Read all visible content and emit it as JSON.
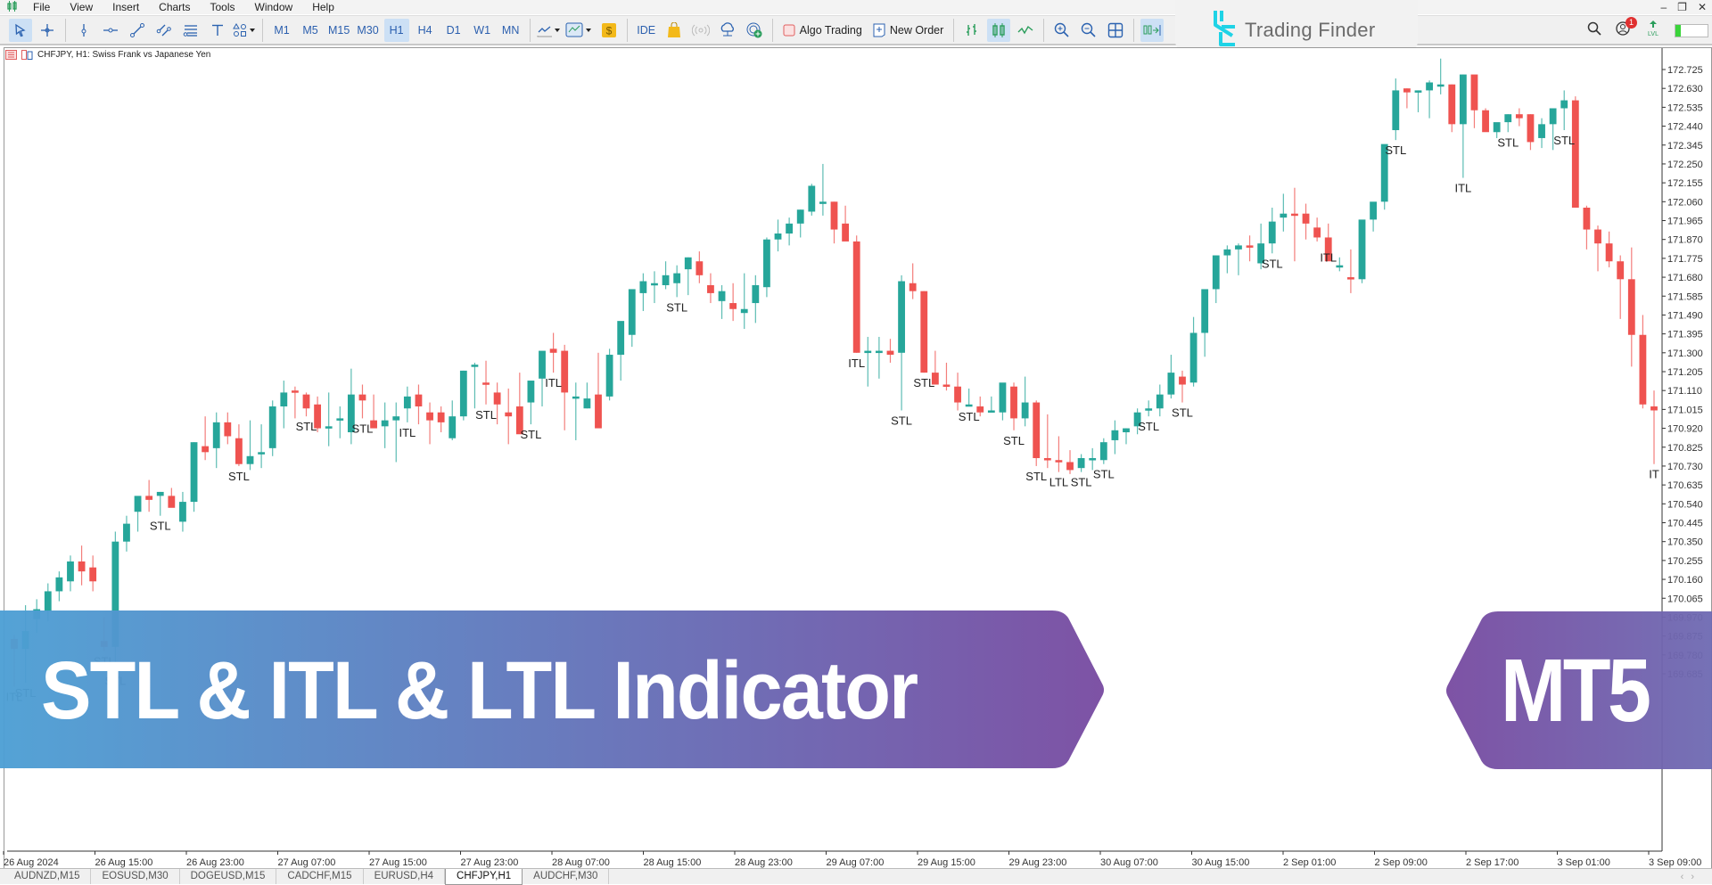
{
  "menu": {
    "items": [
      "File",
      "View",
      "Insert",
      "Charts",
      "Tools",
      "Window",
      "Help"
    ]
  },
  "window_controls": [
    "minimize",
    "restore",
    "close"
  ],
  "toolbar": {
    "tools": [
      {
        "name": "cursor-icon",
        "active": true
      },
      {
        "name": "crosshair-icon",
        "active": false
      },
      {
        "name": "vertical-line-icon",
        "active": false
      },
      {
        "name": "horizontal-line-icon",
        "active": false
      },
      {
        "name": "trendline-icon",
        "active": false
      },
      {
        "name": "channel-icon",
        "active": false
      },
      {
        "name": "fibonacci-icon",
        "active": false
      },
      {
        "name": "text-icon",
        "active": false
      },
      {
        "name": "shapes-icon",
        "active": false
      }
    ],
    "timeframes": [
      "M1",
      "M5",
      "M15",
      "M30",
      "H1",
      "H4",
      "D1",
      "W1",
      "MN"
    ],
    "active_timeframe": "H1",
    "ide_label": "IDE",
    "algo_trading_label": "Algo Trading",
    "new_order_label": "New Order"
  },
  "brand": {
    "name": "Trading Finder"
  },
  "notifications_count": "1",
  "chart": {
    "title": "CHFJPY, H1:  Swiss Frank vs Japanese Yen"
  },
  "tabs": [
    {
      "label": "AUDNZD,M15",
      "active": false
    },
    {
      "label": "EOSUSD,M30",
      "active": false
    },
    {
      "label": "DOGEUSD,M15",
      "active": false
    },
    {
      "label": "CADCHF,M15",
      "active": false
    },
    {
      "label": "EURUSD,H4",
      "active": false
    },
    {
      "label": "CHFJPY,H1",
      "active": true
    },
    {
      "label": "AUDCHF,M30",
      "active": false
    }
  ],
  "banner": {
    "title": "STL & ITL & LTL Indicator",
    "platform": "MT5",
    "gradient_start": "#4d9fd4",
    "gradient_end": "#7b4fa3"
  },
  "chart_data": {
    "type": "candlestick",
    "title": "CHFJPY, H1:  Swiss Frank vs Japanese Yen",
    "symbol": "CHFJPY",
    "timeframe": "H1",
    "bull_color": "#26a69a",
    "bear_color": "#ef5350",
    "ylim": [
      169.62,
      172.82
    ],
    "y_ticks": [
      "172.725",
      "172.630",
      "172.535",
      "172.440",
      "172.345",
      "172.250",
      "172.155",
      "172.060",
      "171.965",
      "171.870",
      "171.775",
      "171.680",
      "171.585",
      "171.490",
      "171.395",
      "171.300",
      "171.205",
      "171.110",
      "171.015",
      "170.920",
      "170.825",
      "170.730",
      "170.635",
      "170.540",
      "170.445",
      "170.350",
      "170.255",
      "170.160",
      "170.065",
      "169.970",
      "169.875",
      "169.780",
      "169.685"
    ],
    "x_ticks": [
      "26 Aug 2024",
      "26 Aug 15:00",
      "26 Aug 23:00",
      "27 Aug 07:00",
      "27 Aug 15:00",
      "27 Aug 23:00",
      "28 Aug 07:00",
      "28 Aug 15:00",
      "28 Aug 23:00",
      "29 Aug 07:00",
      "29 Aug 15:00",
      "29 Aug 23:00",
      "30 Aug 07:00",
      "30 Aug 15:00",
      "2 Sep 01:00",
      "2 Sep 09:00",
      "2 Sep 17:00",
      "3 Sep 01:00",
      "3 Sep 09:00"
    ],
    "candles": [
      [
        169.86,
        169.88,
        169.62,
        169.81
      ],
      [
        169.81,
        170.03,
        169.64,
        169.9
      ],
      [
        169.96,
        170.06,
        169.89,
        170.01
      ],
      [
        170.0,
        170.14,
        169.95,
        170.1
      ],
      [
        170.1,
        170.2,
        170.05,
        170.17
      ],
      [
        170.15,
        170.28,
        170.1,
        170.25
      ],
      [
        170.25,
        170.33,
        170.13,
        170.2
      ],
      [
        170.22,
        170.28,
        170.1,
        170.15
      ],
      [
        169.85,
        169.97,
        169.8,
        169.82
      ],
      [
        169.82,
        170.4,
        169.7,
        170.35
      ],
      [
        170.35,
        170.48,
        170.3,
        170.44
      ],
      [
        170.5,
        170.56,
        170.4,
        170.58
      ],
      [
        170.58,
        170.66,
        170.5,
        170.56
      ],
      [
        170.58,
        170.6,
        170.48,
        170.6
      ],
      [
        170.58,
        170.62,
        170.53,
        170.52
      ],
      [
        170.45,
        170.6,
        170.4,
        170.55
      ],
      [
        170.55,
        170.85,
        170.5,
        170.85
      ],
      [
        170.83,
        170.98,
        170.76,
        170.8
      ],
      [
        170.82,
        171.0,
        170.72,
        170.95
      ],
      [
        170.95,
        171.0,
        170.84,
        170.88
      ],
      [
        170.87,
        170.94,
        170.73,
        170.74
      ],
      [
        170.74,
        170.96,
        170.71,
        170.78
      ],
      [
        170.8,
        170.94,
        170.72,
        170.8
      ],
      [
        170.82,
        171.06,
        170.78,
        171.03
      ],
      [
        171.03,
        171.16,
        170.92,
        171.1
      ],
      [
        171.11,
        171.13,
        170.97,
        171.1
      ],
      [
        171.09,
        171.1,
        170.98,
        171.02
      ],
      [
        171.04,
        171.08,
        170.9,
        170.92
      ],
      [
        170.93,
        171.1,
        170.83,
        170.93
      ],
      [
        170.97,
        171.03,
        170.87,
        170.97
      ],
      [
        170.9,
        171.22,
        170.84,
        171.09
      ],
      [
        171.09,
        171.14,
        170.97,
        171.06
      ],
      [
        170.96,
        171.09,
        170.93,
        170.92
      ],
      [
        170.93,
        171.05,
        170.82,
        170.96
      ],
      [
        170.96,
        171.05,
        170.75,
        170.98
      ],
      [
        171.02,
        171.13,
        170.95,
        171.08
      ],
      [
        171.09,
        171.14,
        170.94,
        171.03
      ],
      [
        171.0,
        171.05,
        170.84,
        170.96
      ],
      [
        171.0,
        171.03,
        170.9,
        170.95
      ],
      [
        170.87,
        171.06,
        170.86,
        170.98
      ],
      [
        170.98,
        171.21,
        170.96,
        171.21
      ],
      [
        171.23,
        171.25,
        171.02,
        171.24
      ],
      [
        171.15,
        171.26,
        171.04,
        171.14
      ],
      [
        171.1,
        171.15,
        170.94,
        171.04
      ],
      [
        171.0,
        171.12,
        170.84,
        170.98
      ],
      [
        171.03,
        171.2,
        170.95,
        170.89
      ],
      [
        171.05,
        171.13,
        170.94,
        171.16
      ],
      [
        171.17,
        171.26,
        171.03,
        171.31
      ],
      [
        171.32,
        171.4,
        171.2,
        171.3
      ],
      [
        171.31,
        171.34,
        170.91,
        171.1
      ],
      [
        171.07,
        171.15,
        170.86,
        171.08
      ],
      [
        171.02,
        171.15,
        171.02,
        171.07
      ],
      [
        171.09,
        171.3,
        171.06,
        170.92
      ],
      [
        171.08,
        171.32,
        171.06,
        171.29
      ],
      [
        171.29,
        171.43,
        171.16,
        171.46
      ],
      [
        171.39,
        171.56,
        171.33,
        171.62
      ],
      [
        171.6,
        171.7,
        171.51,
        171.66
      ],
      [
        171.65,
        171.71,
        171.55,
        171.65
      ],
      [
        171.64,
        171.76,
        171.62,
        171.69
      ],
      [
        171.65,
        171.74,
        171.58,
        171.7
      ],
      [
        171.72,
        171.78,
        171.59,
        171.78
      ],
      [
        171.76,
        171.81,
        171.65,
        171.69
      ],
      [
        171.64,
        171.7,
        171.55,
        171.6
      ],
      [
        171.56,
        171.64,
        171.47,
        171.61
      ],
      [
        171.55,
        171.65,
        171.46,
        171.52
      ],
      [
        171.5,
        171.7,
        171.42,
        171.52
      ],
      [
        171.55,
        171.69,
        171.45,
        171.64
      ],
      [
        171.63,
        171.88,
        171.58,
        171.87
      ],
      [
        171.87,
        171.97,
        171.81,
        171.9
      ],
      [
        171.9,
        171.98,
        171.84,
        171.95
      ],
      [
        171.95,
        172.02,
        171.88,
        172.02
      ],
      [
        172.01,
        172.15,
        171.99,
        172.14
      ],
      [
        172.06,
        172.25,
        171.99,
        172.06
      ],
      [
        172.06,
        172.06,
        171.85,
        171.92
      ],
      [
        171.95,
        172.04,
        171.87,
        171.86
      ],
      [
        171.86,
        171.89,
        171.3,
        171.3
      ],
      [
        171.31,
        171.38,
        171.13,
        171.31
      ],
      [
        171.31,
        171.38,
        171.17,
        171.31
      ],
      [
        171.31,
        171.37,
        171.25,
        171.29
      ],
      [
        171.3,
        171.69,
        171.01,
        171.66
      ],
      [
        171.65,
        171.75,
        171.57,
        171.61
      ],
      [
        171.61,
        171.61,
        171.2,
        171.2
      ],
      [
        171.2,
        171.31,
        171.15,
        171.14
      ],
      [
        171.14,
        171.25,
        171.11,
        171.13
      ],
      [
        171.13,
        171.2,
        171.01,
        171.05
      ],
      [
        171.04,
        171.12,
        171.03,
        171.04
      ],
      [
        171.03,
        171.08,
        170.98,
        171.0
      ],
      [
        171.01,
        171.08,
        171.0,
        171.01
      ],
      [
        171.0,
        171.13,
        170.96,
        171.15
      ],
      [
        171.13,
        171.15,
        170.91,
        170.97
      ],
      [
        170.97,
        171.18,
        170.93,
        171.05
      ],
      [
        171.05,
        171.06,
        170.73,
        170.77
      ],
      [
        170.77,
        170.99,
        170.72,
        170.76
      ],
      [
        170.76,
        170.88,
        170.7,
        170.75
      ],
      [
        170.75,
        170.81,
        170.69,
        170.71
      ],
      [
        170.72,
        170.79,
        170.7,
        170.77
      ],
      [
        170.77,
        170.82,
        170.71,
        170.77
      ],
      [
        170.76,
        170.87,
        170.74,
        170.85
      ],
      [
        170.86,
        170.96,
        170.79,
        170.91
      ],
      [
        170.9,
        170.92,
        170.84,
        170.92
      ],
      [
        170.93,
        171.02,
        170.89,
        171.0
      ],
      [
        171.02,
        171.06,
        170.98,
        171.02
      ],
      [
        171.02,
        171.14,
        170.98,
        171.09
      ],
      [
        171.09,
        171.29,
        171.07,
        171.2
      ],
      [
        171.18,
        171.21,
        171.05,
        171.14
      ],
      [
        171.15,
        171.48,
        171.13,
        171.4
      ],
      [
        171.4,
        171.61,
        171.28,
        171.62
      ],
      [
        171.62,
        171.72,
        171.55,
        171.79
      ],
      [
        171.79,
        171.84,
        171.7,
        171.82
      ],
      [
        171.82,
        171.85,
        171.69,
        171.84
      ],
      [
        171.84,
        171.89,
        171.76,
        171.83
      ],
      [
        171.75,
        171.95,
        171.72,
        171.85
      ],
      [
        171.85,
        172.03,
        171.8,
        171.96
      ],
      [
        171.98,
        172.1,
        171.91,
        172.0
      ],
      [
        172.0,
        172.13,
        171.76,
        171.99
      ],
      [
        172.0,
        172.05,
        171.87,
        171.95
      ],
      [
        171.93,
        171.98,
        171.86,
        171.88
      ],
      [
        171.88,
        171.95,
        171.83,
        171.76
      ],
      [
        171.74,
        171.78,
        171.71,
        171.74
      ],
      [
        171.68,
        171.82,
        171.6,
        171.67
      ],
      [
        171.67,
        171.92,
        171.65,
        171.97
      ],
      [
        171.97,
        172.05,
        171.91,
        172.06
      ],
      [
        172.06,
        172.34,
        172.02,
        172.35
      ],
      [
        172.42,
        172.68,
        172.37,
        172.62
      ],
      [
        172.63,
        172.63,
        172.53,
        172.61
      ],
      [
        172.61,
        172.62,
        172.51,
        172.62
      ],
      [
        172.62,
        172.67,
        172.48,
        172.66
      ],
      [
        172.64,
        172.78,
        172.6,
        172.65
      ],
      [
        172.65,
        172.65,
        172.41,
        172.45
      ],
      [
        172.45,
        172.7,
        172.18,
        172.7
      ],
      [
        172.7,
        172.69,
        172.43,
        172.52
      ],
      [
        172.52,
        172.53,
        172.48,
        172.41
      ],
      [
        172.41,
        172.44,
        172.38,
        172.46
      ],
      [
        172.46,
        172.5,
        172.41,
        172.5
      ],
      [
        172.5,
        172.53,
        172.44,
        172.48
      ],
      [
        172.5,
        172.5,
        172.32,
        172.36
      ],
      [
        172.38,
        172.48,
        172.33,
        172.45
      ],
      [
        172.45,
        172.49,
        172.32,
        172.53
      ],
      [
        172.53,
        172.62,
        172.42,
        172.57
      ],
      [
        172.57,
        172.59,
        172.04,
        172.03
      ],
      [
        172.03,
        172.04,
        171.82,
        171.92
      ],
      [
        171.92,
        171.94,
        171.71,
        171.85
      ],
      [
        171.85,
        171.91,
        171.73,
        171.76
      ],
      [
        171.76,
        171.79,
        171.47,
        171.67
      ],
      [
        171.67,
        171.83,
        171.23,
        171.39
      ],
      [
        171.39,
        171.49,
        171.02,
        171.04
      ],
      [
        171.03,
        171.11,
        170.74,
        171.01
      ]
    ],
    "labels": [
      {
        "text": "ITL",
        "candle": 0,
        "type": "ITL"
      },
      {
        "text": "STL",
        "candle": 1,
        "type": "STL"
      },
      {
        "text": "STL",
        "candle": 8,
        "type": "STL"
      },
      {
        "text": "STL",
        "candle": 9,
        "type": "STL"
      },
      {
        "text": "STL",
        "candle": 13,
        "type": "STL"
      },
      {
        "text": "STL",
        "candle": 20,
        "type": "STL"
      },
      {
        "text": "STL",
        "candle": 26,
        "type": "STL"
      },
      {
        "text": "STL",
        "candle": 31,
        "type": "STL"
      },
      {
        "text": "ITL",
        "candle": 35,
        "type": "ITL"
      },
      {
        "text": "STL",
        "candle": 42,
        "type": "STL"
      },
      {
        "text": "STL",
        "candle": 46,
        "type": "STL"
      },
      {
        "text": "ITL",
        "candle": 48,
        "type": "ITL"
      },
      {
        "text": "STL",
        "candle": 59,
        "type": "STL"
      },
      {
        "text": "ITL",
        "candle": 75,
        "type": "ITL"
      },
      {
        "text": "STL",
        "candle": 79,
        "type": "STL"
      },
      {
        "text": "STL",
        "candle": 81,
        "type": "STL"
      },
      {
        "text": "STL",
        "candle": 85,
        "type": "STL"
      },
      {
        "text": "STL",
        "candle": 89,
        "type": "STL"
      },
      {
        "text": "STL",
        "candle": 91,
        "type": "STL"
      },
      {
        "text": "LTL",
        "candle": 93,
        "type": "LTL"
      },
      {
        "text": "STL",
        "candle": 95,
        "type": "STL"
      },
      {
        "text": "STL",
        "candle": 97,
        "type": "STL"
      },
      {
        "text": "STL",
        "candle": 101,
        "type": "STL"
      },
      {
        "text": "STL",
        "candle": 104,
        "type": "STL"
      },
      {
        "text": "STL",
        "candle": 112,
        "type": "STL"
      },
      {
        "text": "ITL",
        "candle": 117,
        "type": "ITL"
      },
      {
        "text": "STL",
        "candle": 123,
        "type": "STL"
      },
      {
        "text": "ITL",
        "candle": 129,
        "type": "ITL"
      },
      {
        "text": "STL",
        "candle": 133,
        "type": "STL"
      },
      {
        "text": "STL",
        "candle": 138,
        "type": "STL"
      },
      {
        "text": "IT",
        "candle": 146,
        "type": "ITL"
      }
    ]
  }
}
